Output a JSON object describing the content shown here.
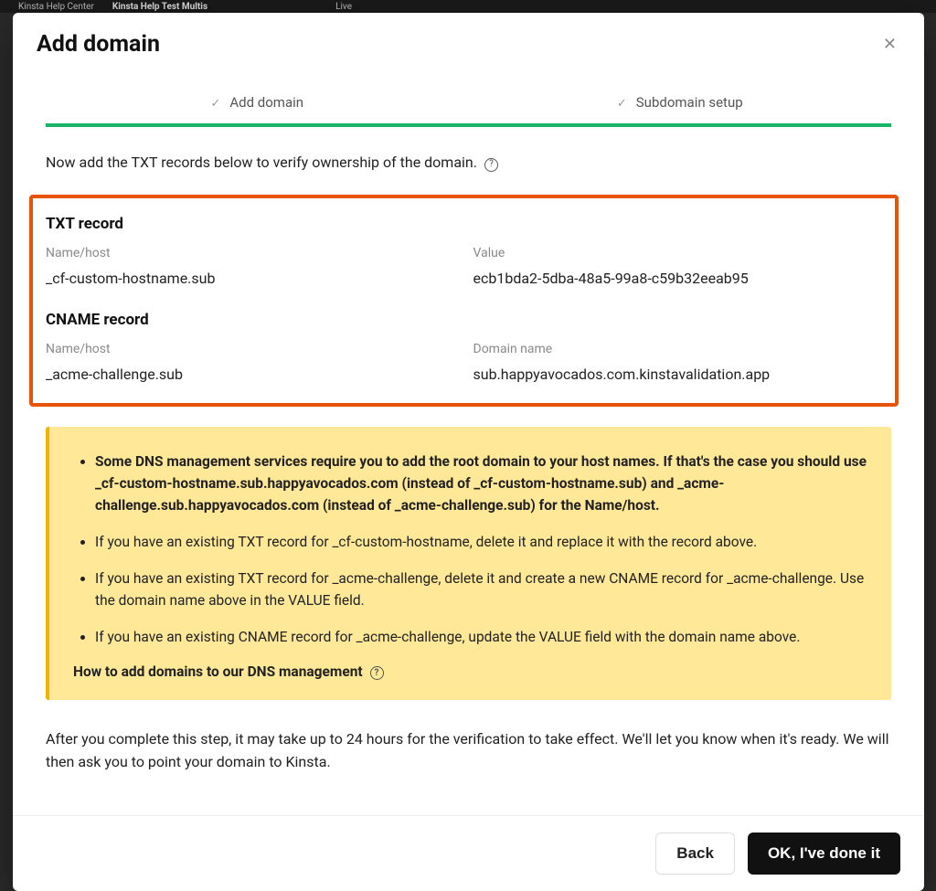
{
  "topbar": {
    "tab1": "Kinsta Help Center",
    "tab2": "Kinsta Help Test Multis",
    "label": "Live"
  },
  "modal": {
    "title": "Add domain",
    "steps": {
      "step1": "Add domain",
      "step2": "Subdomain setup"
    },
    "instruction": "Now add the TXT records below to verify ownership of the domain.",
    "txt_record": {
      "title": "TXT record",
      "name_label": "Name/host",
      "name_value": "_cf-custom-hostname.sub",
      "value_label": "Value",
      "value_value": "ecb1bda2-5dba-48a5-99a8-c59b32eeab95"
    },
    "cname_record": {
      "title": "CNAME record",
      "name_label": "Name/host",
      "name_value": "_acme-challenge.sub",
      "domain_label": "Domain name",
      "domain_value": "sub.happyavocados.com.kinstavalidation.app"
    },
    "notice": {
      "li1_part1": "Some DNS management services require you to add the root domain to your host names. If that's the case you should use ",
      "li1_host1": "_cf-custom-hostname.sub.happyavocados.com",
      "li1_part2": " (instead of _cf-custom-hostname.sub) and ",
      "li1_host2": "_acme-challenge.sub.happyavocados.com",
      "li1_part3": " (instead of _acme-challenge.sub) for the Name/host.",
      "li2": "If you have an existing TXT record for _cf-custom-hostname, delete it and replace it with the record above.",
      "li3": "If you have an existing TXT record for _acme-challenge, delete it and create a new CNAME record for _acme-challenge. Use the domain name above in the VALUE field.",
      "li4": "If you have an existing CNAME record for _acme-challenge, update the VALUE field with the domain name above.",
      "link": "How to add domains to our DNS management"
    },
    "after": "After you complete this step, it may take up to 24 hours for the verification to take effect. We'll let you know when it's ready. We will then ask you to point your domain to Kinsta.",
    "back": "Back",
    "confirm": "OK, I've done it"
  }
}
